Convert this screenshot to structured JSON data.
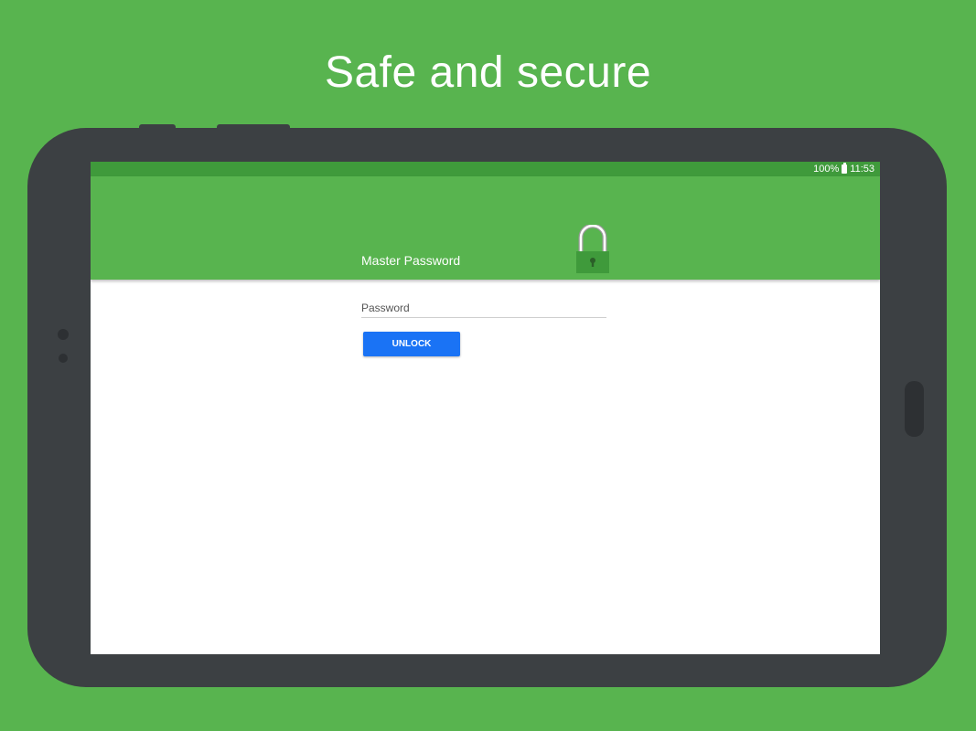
{
  "headline": "Safe and secure",
  "colors": {
    "background": "#58b44f",
    "device": "#3c4043",
    "status_bar": "#3f9a3b",
    "app_bar": "#58b44f",
    "accent_button": "#1a73f5",
    "lock_body": "#3f9a3b"
  },
  "status_bar": {
    "battery": "100%",
    "battery_icon": "battery-full-icon",
    "time": "11:53"
  },
  "app_bar": {
    "title": "Master Password",
    "icon": "padlock-icon"
  },
  "form": {
    "password_placeholder": "Password",
    "unlock_label": "UNLOCK"
  }
}
